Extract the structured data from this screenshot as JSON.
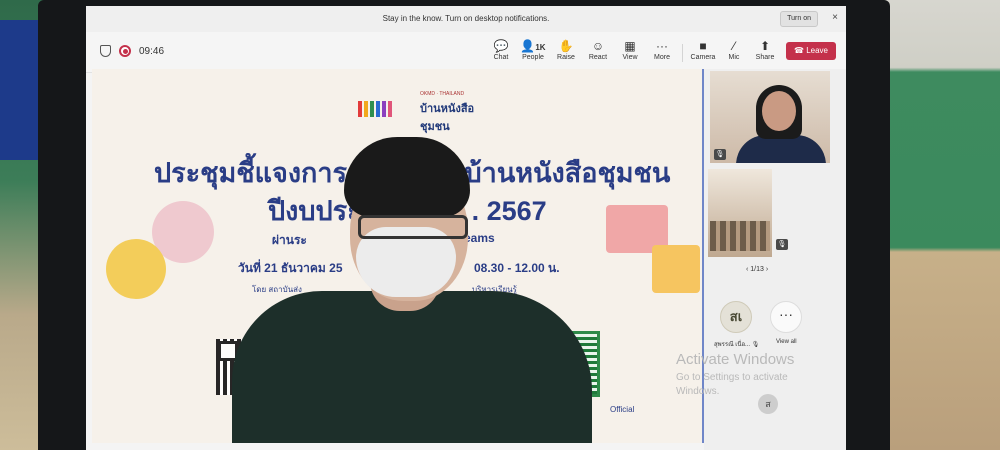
{
  "notification": {
    "message": "Stay in the know. Turn on desktop notifications.",
    "turn_on": "Turn on",
    "close": "×"
  },
  "toolbar": {
    "elapsed": "09:46",
    "items": [
      {
        "icon": "chat-icon",
        "glyph": "💬",
        "label": "Chat"
      },
      {
        "icon": "people-icon",
        "glyph": "👤",
        "badge": "1K",
        "label": "People"
      },
      {
        "icon": "raise-hand-icon",
        "glyph": "✋",
        "label": "Raise"
      },
      {
        "icon": "react-icon",
        "glyph": "☺",
        "label": "React"
      },
      {
        "icon": "view-icon",
        "glyph": "▦",
        "label": "View"
      },
      {
        "icon": "more-icon",
        "glyph": "···",
        "label": "More"
      },
      {
        "icon": "camera-off-icon",
        "glyph": "■",
        "label": "Camera"
      },
      {
        "icon": "mic-off-icon",
        "glyph": "⁄",
        "label": "Mic"
      },
      {
        "icon": "share-icon",
        "glyph": "⬆",
        "label": "Share"
      }
    ],
    "leave": "Leave"
  },
  "slide": {
    "logo_sub": "OKMD · THAILAND",
    "logo_text": "บ้านหนังสือชุมชน",
    "title_line1": "ประชุมชี้แจงการด",
    "title_line1b": "บ้านหนังสือชุมชน",
    "title_line2": "ปีงบประ",
    "title_line2b": ". 2567",
    "via": "ผ่านระ",
    "via_b": "eams",
    "date": "วันที่ 21 ธันวาคม 25",
    "time": "08.30 - 12.00 น.",
    "by": "โดย สถาบันส่ง",
    "by_b": "บริหารเรียนรู้",
    "official": "Official"
  },
  "panel": {
    "pager": "1/13",
    "participant_initials": "สเ",
    "participant_name": "สุพรรณี เนื่อ...",
    "view_all": "View all",
    "small_initial": "ส"
  },
  "watermark": {
    "title": "Activate Windows",
    "subtitle": "Go to Settings to activate Windows."
  },
  "colors": {
    "leave": "#c4314b",
    "slide_title": "#2a3d86",
    "accent_line": "#6f86c8"
  }
}
